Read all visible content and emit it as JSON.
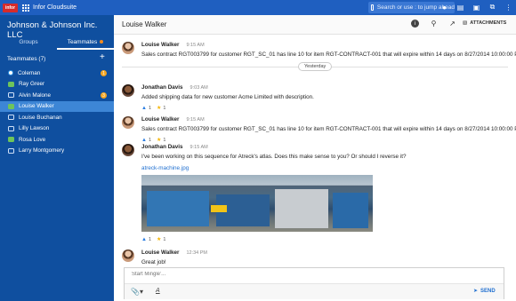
{
  "topbar": {
    "logo_text": "infor",
    "app_name": "Infor Cloudsuite",
    "search_placeholder": "Search or use : to jump ahead",
    "icons": [
      "user-icon",
      "inbox-icon",
      "chat-icon",
      "share-icon",
      "menu-icon"
    ]
  },
  "sidebar": {
    "org_name": "Johnson & Johnson Inc. LLC",
    "tabs": [
      {
        "label": "Groups"
      },
      {
        "label": "Teammates"
      }
    ],
    "teammates_header": "Teammates (7)",
    "add_label": "+",
    "people": [
      {
        "name": "Coleman",
        "status": "ring",
        "badge": "1"
      },
      {
        "name": "Ray Greer",
        "status": "online",
        "badge": ""
      },
      {
        "name": "Alvin Malone",
        "status": "offline",
        "badge": "3"
      },
      {
        "name": "Louise Walker",
        "status": "online",
        "badge": ""
      },
      {
        "name": "Louise Buchanan",
        "status": "offline",
        "badge": ""
      },
      {
        "name": "Lilly Lawson",
        "status": "offline",
        "badge": ""
      },
      {
        "name": "Rosa Love",
        "status": "online",
        "badge": ""
      },
      {
        "name": "Larry Montgomery",
        "status": "offline",
        "badge": ""
      }
    ]
  },
  "main": {
    "title": "Louise Walker",
    "attachments_label": "ATTACHMENTS",
    "divider_label": "Yesterday",
    "messages": [
      {
        "name": "Louise Walker",
        "time": "9:15 AM",
        "text": "Sales contract RGT003799 for customer RGT_SC_01 has line 10 for item RGT-CONTRACT-001 that will expire within 14 days on 8/27/2014 10:00:00 PM."
      },
      {
        "name": "Jonathan Davis",
        "time": "9:03 AM",
        "text": "Added shipping data for new customer Acme Limited with description.",
        "likes": "1",
        "stars": "1"
      },
      {
        "name": "Louise Walker",
        "time": "9:15 AM",
        "text": "Sales contract RGT003799 for customer RGT_SC_01 has line 10 for item RGT-CONTRACT-001 that will expire within 14 days on 8/27/2014 10:00:00 PM.",
        "likes": "1",
        "stars": "1"
      },
      {
        "name": "Jonathan Davis",
        "time": "9:15 AM",
        "text": "I've been working on this sequence for Atreck's atlas. Does this make sense to you? Or should I reverse it?",
        "link": "atreck-machine.jpg",
        "likes": "1",
        "stars": "1"
      },
      {
        "name": "Louise Walker",
        "time": "12:34 PM",
        "text": "Great job!"
      }
    ]
  },
  "composer": {
    "placeholder": "Start Mingle'...",
    "send_label": "SEND"
  }
}
